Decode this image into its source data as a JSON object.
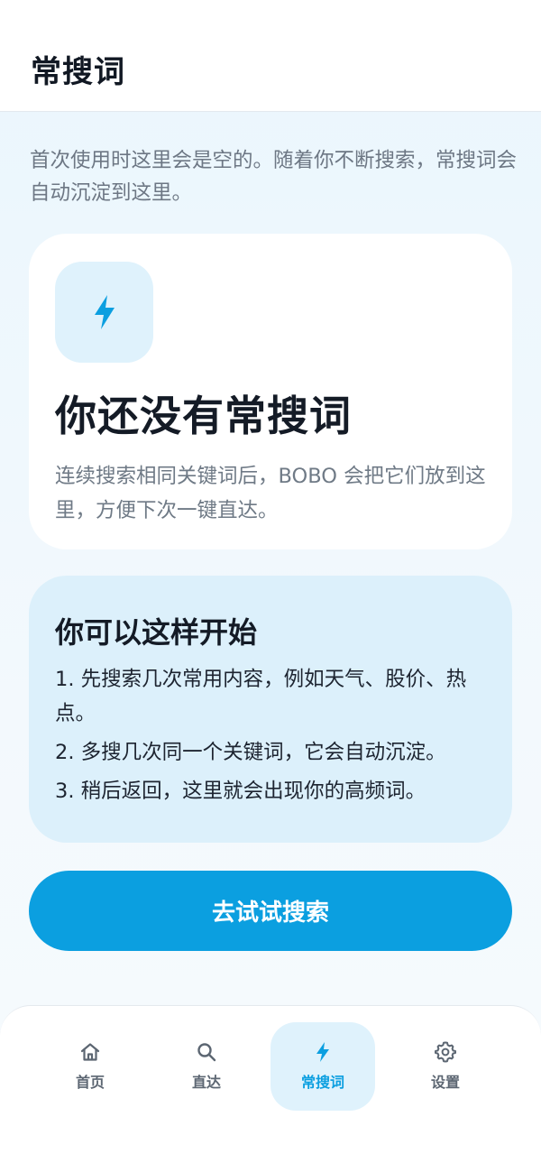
{
  "header": {
    "title": "常搜词"
  },
  "intro": "首次使用时这里会是空的。随着你不断搜索，常搜词会自动沉淀到这里。",
  "empty_state": {
    "icon": "bolt-icon",
    "title": "你还没有常搜词",
    "description": "连续搜索相同关键词后，BOBO 会把它们放到这里，方便下次一键直达。"
  },
  "tips": {
    "title": "你可以这样开始",
    "items": [
      "1. 先搜索几次常用内容，例如天气、股价、热点。",
      "2. 多搜几次同一个关键词，它会自动沉淀。",
      "3. 稍后返回，这里就会出现你的高频词。"
    ]
  },
  "cta": {
    "label": "去试试搜索"
  },
  "tabbar": {
    "active": "常搜词",
    "items": [
      {
        "label": "首页",
        "icon": "home-icon"
      },
      {
        "label": "直达",
        "icon": "search-icon"
      },
      {
        "label": "常搜词",
        "icon": "bolt-icon"
      },
      {
        "label": "设置",
        "icon": "gear-icon"
      }
    ]
  },
  "colors": {
    "accent": "#0b9fe0",
    "accent_soft": "#dff2fc",
    "text_primary": "#141b26",
    "text_secondary": "#6f7a86"
  }
}
